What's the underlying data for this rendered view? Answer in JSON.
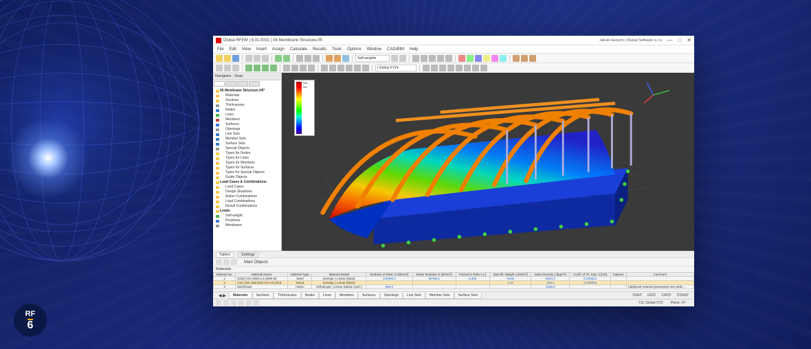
{
  "badge": {
    "letters": "RF",
    "number": "6"
  },
  "window": {
    "title": "Dlubal RFEM | 6.01.0001 | 06 Membrane Structure.rf5",
    "right_text": "Jakub Harazín | Dlubal Software s.r.o."
  },
  "menu": [
    "File",
    "Edit",
    "View",
    "Insert",
    "Assign",
    "Calculate",
    "Results",
    "Tools",
    "Options",
    "Window",
    "CAD/BIM",
    "Help"
  ],
  "toolbars": {
    "dropdowns": {
      "selfweight": "Self-weight",
      "globalxyz": "| Global XYZ"
    }
  },
  "navigator": {
    "header": "Navigator - Data",
    "root": "06 Membrane Structure.rf5*",
    "items": [
      {
        "lvl": 2,
        "cls": "folder",
        "label": "Materials"
      },
      {
        "lvl": 2,
        "cls": "folder",
        "label": "Sections"
      },
      {
        "lvl": 2,
        "cls": "gray",
        "label": "Thicknesses"
      },
      {
        "lvl": 2,
        "cls": "blue",
        "label": "Nodes"
      },
      {
        "lvl": 2,
        "cls": "green",
        "label": "Lines"
      },
      {
        "lvl": 2,
        "cls": "red",
        "label": "Members"
      },
      {
        "lvl": 2,
        "cls": "blue",
        "label": "Surfaces"
      },
      {
        "lvl": 2,
        "cls": "gray",
        "label": "Openings"
      },
      {
        "lvl": 2,
        "cls": "blue",
        "label": "Line Sets"
      },
      {
        "lvl": 2,
        "cls": "blue",
        "label": "Member Sets"
      },
      {
        "lvl": 2,
        "cls": "blue",
        "label": "Surface Sets"
      },
      {
        "lvl": 2,
        "cls": "gray",
        "label": "Special Objects"
      },
      {
        "lvl": 2,
        "cls": "folder",
        "label": "Types for Nodes"
      },
      {
        "lvl": 2,
        "cls": "folder",
        "label": "Types for Lines"
      },
      {
        "lvl": 2,
        "cls": "folder",
        "label": "Types for Members"
      },
      {
        "lvl": 2,
        "cls": "folder",
        "label": "Types for Surfaces"
      },
      {
        "lvl": 2,
        "cls": "folder",
        "label": "Types for Special Objects"
      },
      {
        "lvl": 2,
        "cls": "folder",
        "label": "Guide Objects"
      },
      {
        "lvl": 1,
        "cls": "folder",
        "label": "Load Cases & Combinations"
      },
      {
        "lvl": 2,
        "cls": "folder",
        "label": "Load Cases"
      },
      {
        "lvl": 2,
        "cls": "folder",
        "label": "Design Situations"
      },
      {
        "lvl": 2,
        "cls": "folder",
        "label": "Action Combinations"
      },
      {
        "lvl": 2,
        "cls": "folder",
        "label": "Load Combinations"
      },
      {
        "lvl": 2,
        "cls": "folder",
        "label": "Result Combinations"
      },
      {
        "lvl": 1,
        "cls": "folder",
        "label": "Loads"
      },
      {
        "lvl": 2,
        "cls": "green",
        "label": "Self-weight"
      },
      {
        "lvl": 2,
        "cls": "blue",
        "label": "Prestress"
      },
      {
        "lvl": 2,
        "cls": "gray",
        "label": "Membrane"
      }
    ]
  },
  "legend_ticks": [
    "Max",
    "",
    "",
    "",
    "",
    "",
    "",
    "",
    "",
    "",
    "Min"
  ],
  "panel": {
    "tabs": [
      "Tables",
      "Settings"
    ],
    "sub": "Main Objects",
    "heading": "Materials",
    "bottom_tabs": [
      "Materials",
      "Sections",
      "Thicknesses",
      "Nodes",
      "Lines",
      "Members",
      "Surfaces",
      "Openings",
      "Line Sets",
      "Member Sets",
      "Surface Sets"
    ],
    "snap": [
      "SNAP",
      "GRID",
      "CARD",
      "OSNAP"
    ]
  },
  "table": {
    "columns": [
      "Material No.",
      "Material Name",
      "Material Type",
      "Material Model",
      "Modulus of Elast. E [N/mm²]",
      "Shear Modulus G [N/mm²]",
      "Poisson's Ratio ν [-]",
      "Specific Weight γ [kN/m³]",
      "Mass Density ρ [kg/m³]",
      "Coeff. of Th. Exp. α [1/K]",
      "Options",
      "Comment"
    ],
    "rows": [
      {
        "hl": false,
        "cells": [
          "1",
          "S235 | EN 1993-1-1:2005-05",
          "Steel",
          "Isotropic | Linear Elastic",
          "210000.0",
          "80769.2",
          "0.300",
          "78.50",
          "8004.3",
          "0.000012",
          "",
          ""
        ]
      },
      {
        "hl": true,
        "cells": [
          "2",
          "C16 | EN 338:2016-04+A2:2018",
          "Wood",
          "Isotropic | Linear Elastic",
          "",
          "",
          "",
          "4.12",
          "419.2",
          "0.000005",
          "",
          ""
        ]
      },
      {
        "hl": false,
        "cells": [
          "3",
          "Membrane",
          "Fabric",
          "Orthotropic | Linear Elastic (Surf.)",
          "800.0",
          "",
          "",
          "",
          "2000.0",
          "",
          "",
          "Additional material parameters are defin…"
        ]
      }
    ]
  },
  "statusbar": {
    "cs": "CS: Global XYZ",
    "plane": "Plane: XY"
  }
}
